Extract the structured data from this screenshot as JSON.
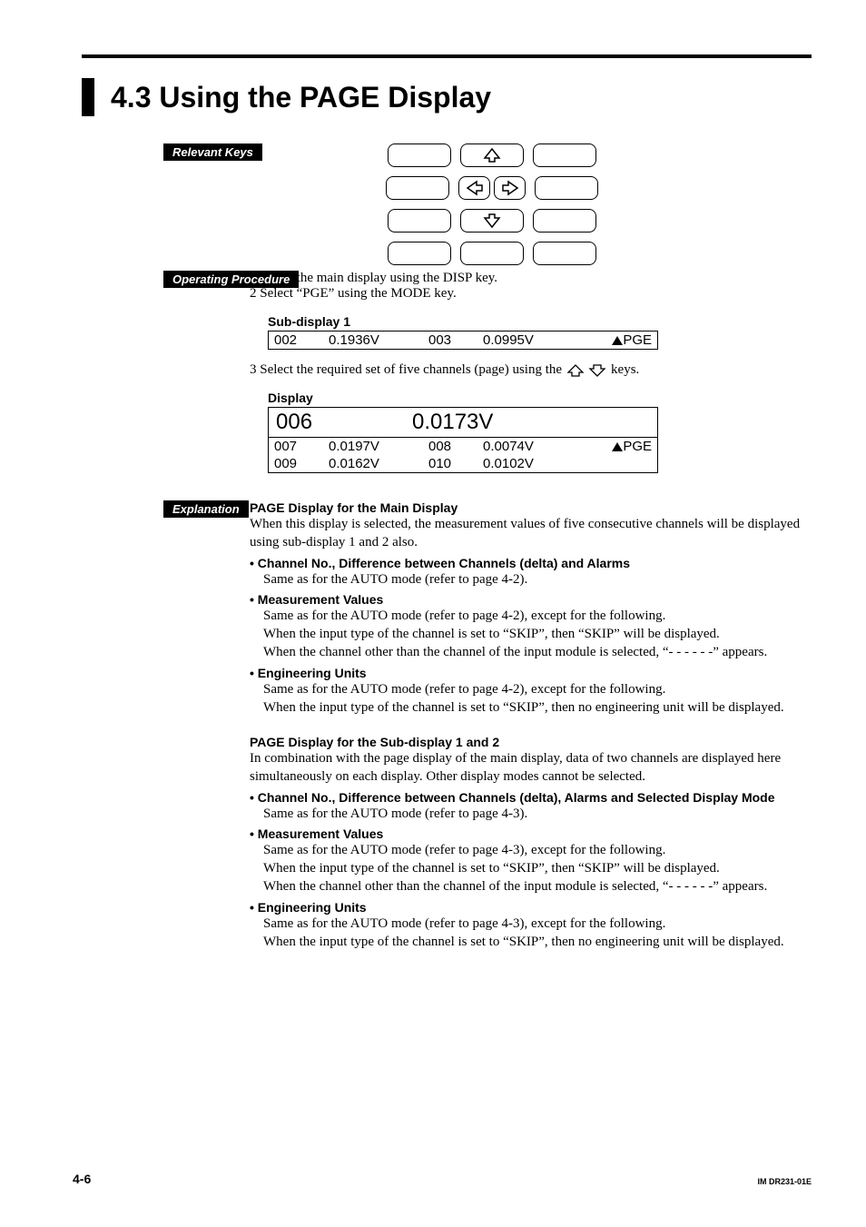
{
  "title": "4.3  Using the PAGE Display",
  "labels": {
    "relevant_keys": "Relevant Keys",
    "operating_procedure": "Operating Procedure",
    "explanation": "Explanation"
  },
  "procedure": {
    "step1": "1  Select the main display using the DISP key.",
    "step2": "2  Select “PGE” using the MODE key.",
    "step3a": "3  Select the required set of five channels (page) using the",
    "step3b": "keys."
  },
  "sub1": {
    "heading": "Sub-display 1",
    "ch1": "002",
    "v1": "0.1936V",
    "ch2": "003",
    "v2": "0.0995V",
    "mode": "PGE"
  },
  "display": {
    "heading": "Display",
    "big_ch": "006",
    "big_v": "0.0173V",
    "r1c1": "007",
    "r1v1": "0.0197V",
    "r1c2": "008",
    "r1v2": "0.0074V",
    "mode": "PGE",
    "r2c1": "009",
    "r2v1": "0.0162V",
    "r2c2": "010",
    "r2v2": "0.0102V"
  },
  "exp": {
    "h1": "PAGE Display for the Main Display",
    "p1": "When this display is selected, the measurement values of five consecutive channels will be displayed using sub-display 1 and 2 also.",
    "b1": "Channel No., Difference between Channels (delta) and Alarms",
    "b1body": "Same as for the AUTO mode (refer to page 4-2).",
    "b2": "Measurement Values",
    "b2body1": "Same as for the AUTO mode (refer to page 4-2), except for the following.",
    "b2body2": "When the input type of the channel is set to “SKIP”, then “SKIP” will be displayed.",
    "b2body3": "When the channel other than the channel of the input module is selected, “- - - - - -” appears.",
    "b3": "Engineering Units",
    "b3body1": "Same as for the AUTO mode (refer to page 4-2), except for the following.",
    "b3body2": "When the input type of the channel is set to “SKIP”, then no engineering unit will be displayed.",
    "h2": "PAGE Display for the Sub-display 1 and 2",
    "p2": "In combination with the page display of the main display, data of two channels are displayed here simultaneously on each display. Other display modes cannot be selected.",
    "b4": "Channel No., Difference between Channels (delta), Alarms and Selected Display Mode",
    "b4body": "Same as for the AUTO mode (refer to page 4-3).",
    "b5": "Measurement Values",
    "b5body1": "Same as for the AUTO mode (refer to page 4-3), except for the following.",
    "b5body2": "When the input type of the channel is set to “SKIP”, then “SKIP” will be displayed.",
    "b5body3": "When the channel other than the channel of the input module is selected, “- - - - - -” appears.",
    "b6": "Engineering Units",
    "b6body1": "Same as for the AUTO mode (refer to page 4-3), except for the following.",
    "b6body2": "When the input type of the channel is set to “SKIP”, then no engineering unit will be displayed."
  },
  "footer": {
    "page": "4-6",
    "doc": "IM DR231-01E"
  }
}
